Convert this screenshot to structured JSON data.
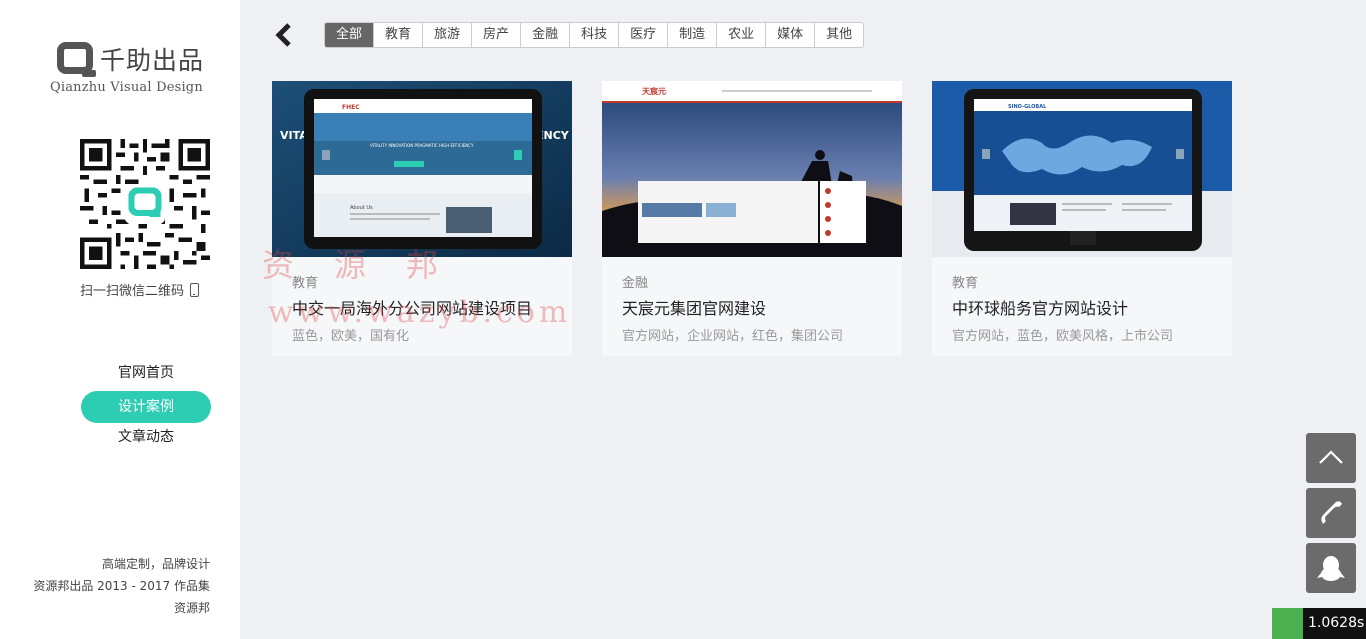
{
  "brand": {
    "name": "千助出品",
    "subtitle": "Qianzhu Visual Design"
  },
  "qr": {
    "label": "扫一扫微信二维码"
  },
  "nav": {
    "items": [
      {
        "label": "官网首页",
        "active": false
      },
      {
        "label": "设计案例",
        "active": true
      },
      {
        "label": "文章动态",
        "active": false
      }
    ]
  },
  "footer": {
    "line1": "高端定制，品牌设计",
    "line2": "资源邦出品  2013 - 2017 作品集",
    "line3": "资源邦"
  },
  "filters": {
    "tabs": [
      "全部",
      "教育",
      "旅游",
      "房产",
      "金融",
      "科技",
      "医疗",
      "制造",
      "农业",
      "媒体",
      "其他"
    ],
    "active_index": 0
  },
  "cards": [
    {
      "category": "教育",
      "title": "中交一局海外分公司网站建设项目",
      "tags": "蓝色，欧美，国有化",
      "thumb_header": "FHEC",
      "thumb_slogan": "VITALITY INNOVATION PRAGMATIC HIGH EFFICIENCY",
      "thumb_side_left": "VITA",
      "thumb_side_right": "ENCY",
      "thumb_about": "About Us"
    },
    {
      "category": "金融",
      "title": "天宸元集团官网建设",
      "tags": "官方网站，企业网站，红色，集团公司",
      "thumb_header": "天宸元"
    },
    {
      "category": "教育",
      "title": "中环球船务官方网站设计",
      "tags": "官方网站，蓝色，欧美风格，上市公司",
      "thumb_header": "SINO-GLOBAL"
    }
  ],
  "watermark": {
    "text": "资源邦",
    "url": "www.wazyb.com"
  },
  "timer": {
    "value": "1.0628s"
  },
  "colors": {
    "accent": "#2dcdb4",
    "sidebar_bg": "#ffffff",
    "main_bg": "#eef0f3",
    "float_btn": "#6b6b6b"
  }
}
